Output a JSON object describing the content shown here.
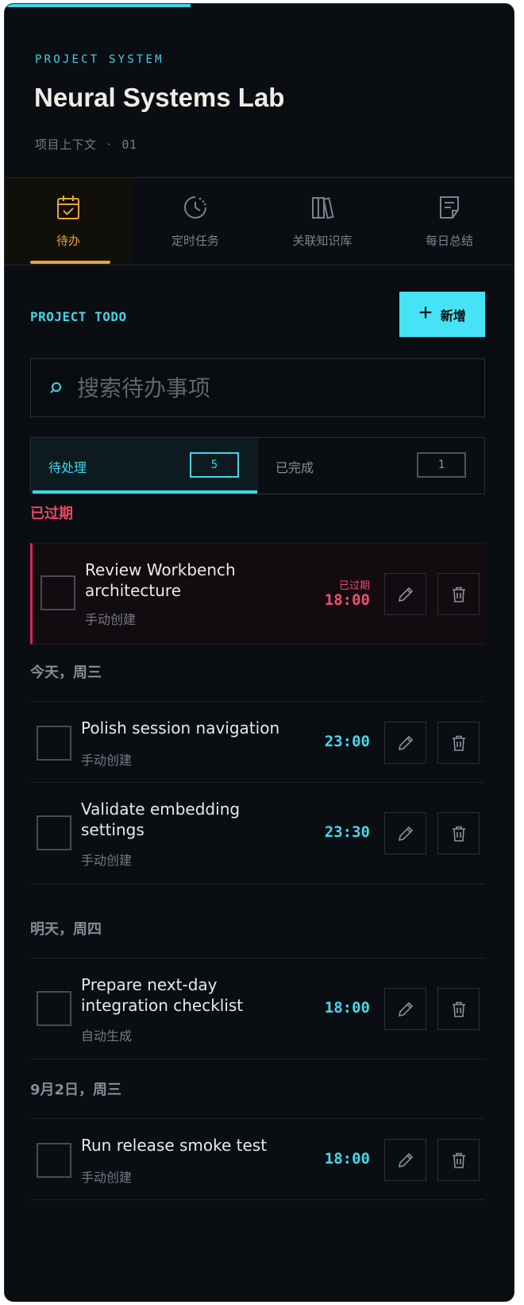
{
  "app": {
    "eyebrow": "PROJECT SYSTEM",
    "title": "Neural Systems Lab",
    "subtitle_label": "项目上下文",
    "subtitle_sep": "·",
    "subtitle_num": "01",
    "accent": "#3fd6ea",
    "tab_accent": "#e9a631",
    "danger": "#ef4767"
  },
  "tabs": [
    {
      "label": "待办",
      "icon": "calendar-check-icon",
      "active": true
    },
    {
      "label": "定时任务",
      "icon": "clock-schedule-icon",
      "active": false
    },
    {
      "label": "关联知识库",
      "icon": "books-icon",
      "active": false
    },
    {
      "label": "每日总结",
      "icon": "document-edit-icon",
      "active": false
    }
  ],
  "todo": {
    "heading": "PROJECT TODO",
    "add_label": "新增",
    "add_icon": "plus-icon",
    "search_placeholder": "搜索待办事项",
    "filters": [
      {
        "label": "待处理",
        "count": "5",
        "active": true
      },
      {
        "label": "已完成",
        "count": "1",
        "active": false
      }
    ]
  },
  "groups": [
    {
      "title": "已过期",
      "overdue": true,
      "items": [
        {
          "title": "Review Workbench architecture",
          "source": "手动创建",
          "time": "18:00",
          "tag": "已过期"
        }
      ]
    },
    {
      "title": "今天，周三",
      "overdue": false,
      "items": [
        {
          "title": "Polish session navigation",
          "source": "手动创建",
          "time": "23:00"
        },
        {
          "title": "Validate embedding settings",
          "source": "手动创建",
          "time": "23:30"
        }
      ]
    },
    {
      "title": "明天，周四",
      "overdue": false,
      "items": [
        {
          "title": "Prepare next-day integration checklist",
          "source": "自动生成",
          "time": "18:00"
        }
      ]
    },
    {
      "title": "9月2日，周三",
      "overdue": false,
      "items": [
        {
          "title": "Run release smoke test",
          "source": "手动创建",
          "time": "18:00"
        }
      ]
    }
  ]
}
